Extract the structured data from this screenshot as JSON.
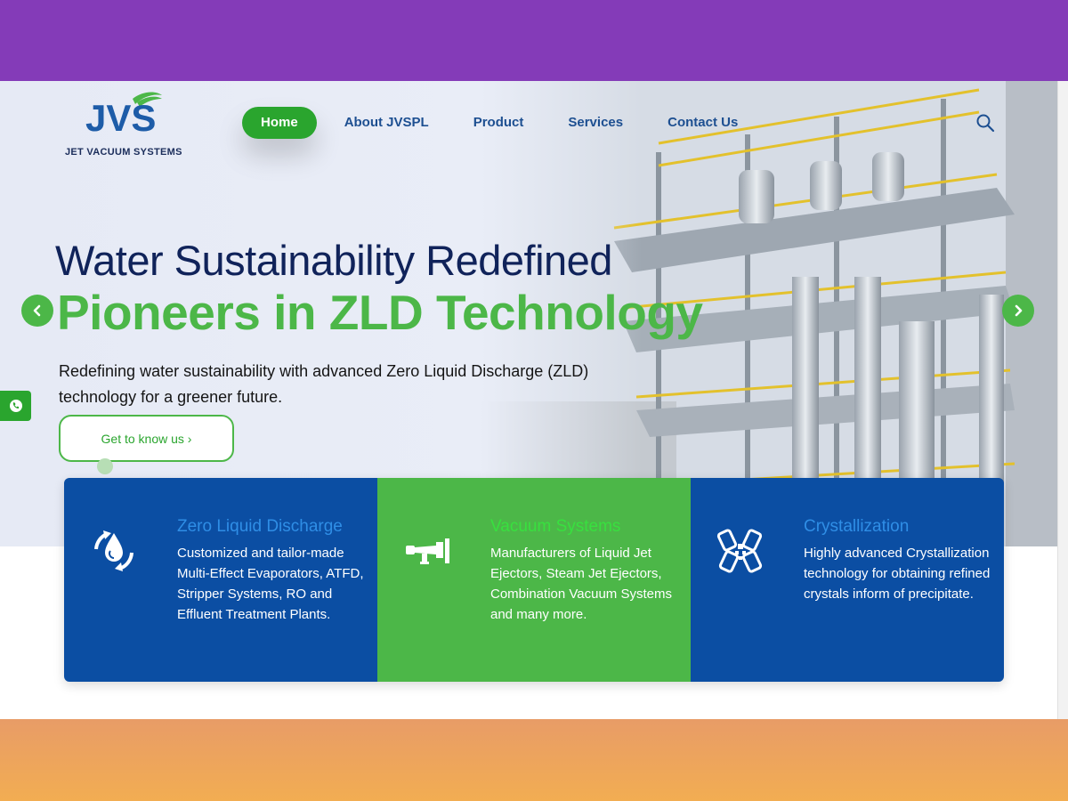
{
  "brand": {
    "logo_text": "JVS",
    "logo_subtitle": "JET VACUUM SYSTEMS"
  },
  "nav": {
    "items": [
      {
        "label": "Home",
        "active": true
      },
      {
        "label": "About JVSPL",
        "active": false
      },
      {
        "label": "Product",
        "active": false
      },
      {
        "label": "Services",
        "active": false
      },
      {
        "label": "Contact Us",
        "active": false
      }
    ],
    "search_icon": "search-icon"
  },
  "hero": {
    "title": "Water Sustainability Redefined",
    "subtitle": "Pioneers in ZLD Technology",
    "description": "Redefining water sustainability with advanced Zero Liquid Discharge (ZLD) technology for a greener future.",
    "cta_label": "Get to know us ›",
    "prev_icon": "chevron-left-icon",
    "next_icon": "chevron-right-icon"
  },
  "side_tab": {
    "icon": "phone-icon"
  },
  "services": [
    {
      "title": "Zero Liquid Discharge",
      "text": "Customized and tailor-made Multi-Effect Evaporators, ATFD, Stripper Systems, RO and Effluent Treatment Plants.",
      "icon": "water-cycle-icon"
    },
    {
      "title": "Vacuum Systems",
      "text": "Manufacturers of Liquid Jet Ejectors, Steam Jet Ejectors, Combination Vacuum Systems and many more.",
      "icon": "ejector-icon"
    },
    {
      "title": "Crystallization",
      "text": "Highly advanced Crystallization technology for obtaining refined crystals inform of precipitate.",
      "icon": "crystal-icon"
    }
  ],
  "colors": {
    "top_band": "#843bb8",
    "primary_blue": "#0b4ea3",
    "brand_green": "#4cb748",
    "active_green": "#2aa52e",
    "navy_text": "#10235a"
  }
}
